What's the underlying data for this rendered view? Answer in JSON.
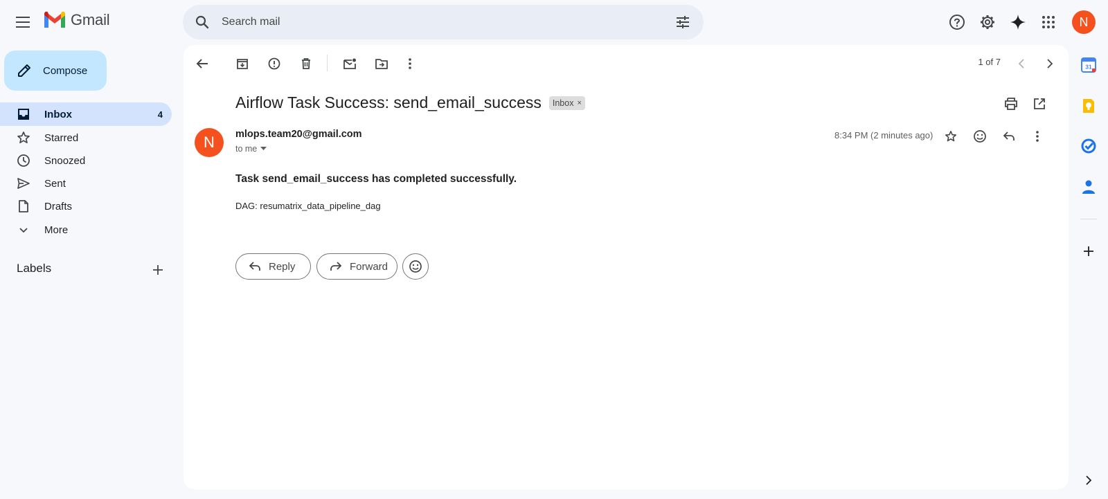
{
  "header": {
    "logo_text": "Gmail",
    "search_placeholder": "Search mail",
    "avatar_initial": "N"
  },
  "sidebar": {
    "compose_label": "Compose",
    "items": [
      {
        "label": "Inbox",
        "count": "4",
        "icon": "inbox-icon",
        "active": true
      },
      {
        "label": "Starred",
        "icon": "star-icon"
      },
      {
        "label": "Snoozed",
        "icon": "clock-icon"
      },
      {
        "label": "Sent",
        "icon": "send-icon"
      },
      {
        "label": "Drafts",
        "icon": "draft-icon"
      },
      {
        "label": "More",
        "icon": "chevron-down-icon"
      }
    ],
    "labels_title": "Labels"
  },
  "toolbar": {
    "pager": "1 of 7"
  },
  "message": {
    "subject": "Airflow Task Success: send_email_success",
    "chip": "Inbox",
    "chip_close": "×",
    "sender_initial": "N",
    "sender_email": "mlops.team20@gmail.com",
    "to": "to me",
    "timestamp": "8:34 PM (2 minutes ago)",
    "body_heading": "Task send_email_success has completed successfully.",
    "body_dag": "DAG: resumatrix_data_pipeline_dag",
    "reply_label": "Reply",
    "forward_label": "Forward"
  },
  "side_panel": {
    "calendar_day": "31"
  },
  "colors": {
    "background": "#f6f8fc",
    "compose": "#c2e7ff",
    "active_nav": "#d3e3fd",
    "avatar": "#f4511e",
    "search": "#e9eef6"
  }
}
